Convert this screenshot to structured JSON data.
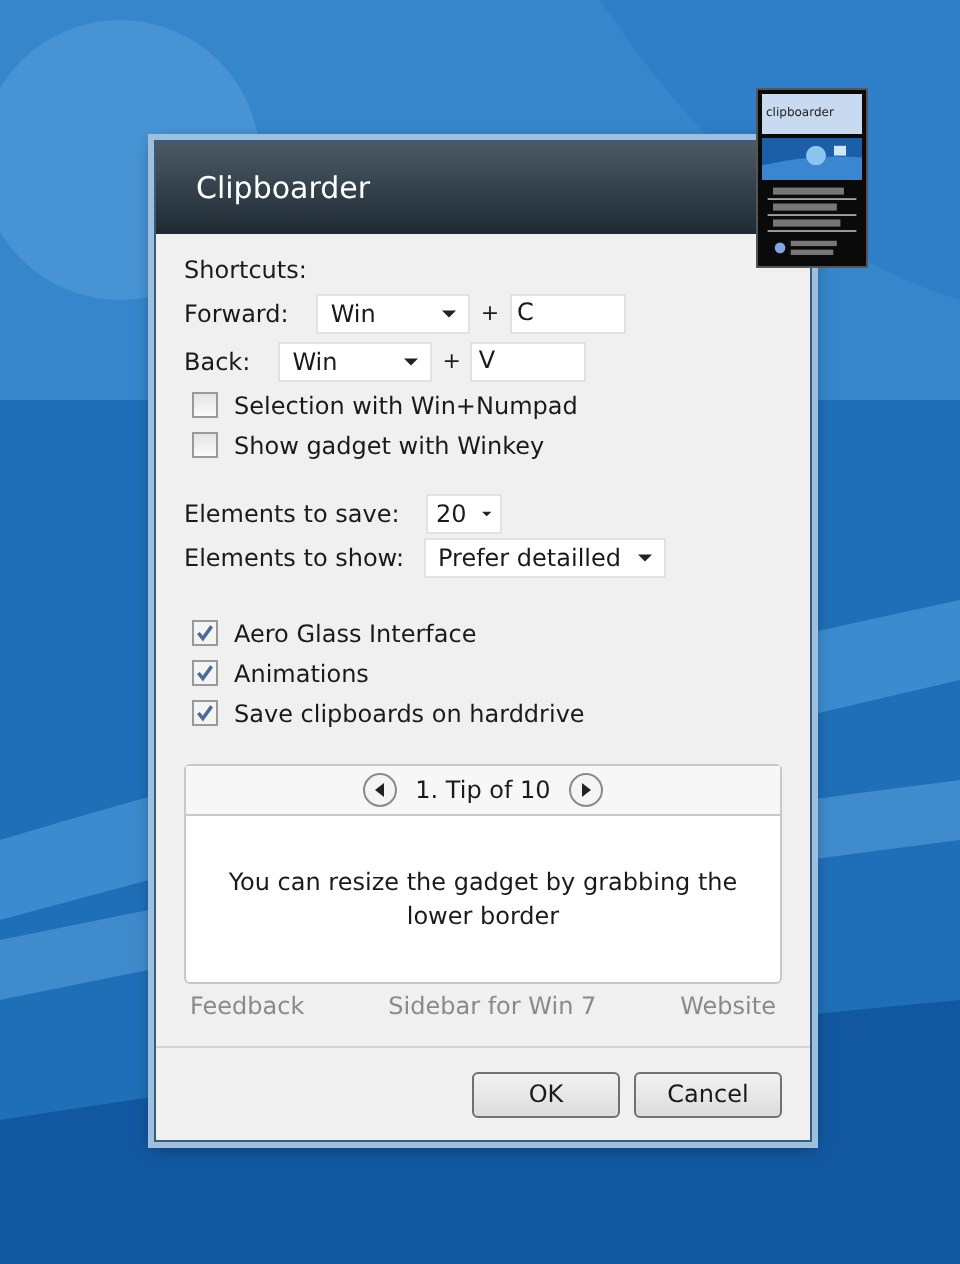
{
  "dialog": {
    "title": "Clipboarder",
    "section_label": "Shortcuts:",
    "shortcuts": [
      {
        "label": "Forward:",
        "modifier": "Win",
        "plus": "+",
        "key": "C"
      },
      {
        "label": "Back:",
        "modifier": "Win",
        "plus": "+",
        "key": "V"
      }
    ],
    "options_top": [
      {
        "label": "Selection with Win+Numpad",
        "checked": false
      },
      {
        "label": "Show gadget with Winkey",
        "checked": false
      }
    ],
    "selects": [
      {
        "label": "Elements to save:",
        "value": "20"
      },
      {
        "label": "Elements to show:",
        "value": "Prefer detailled"
      }
    ],
    "options_bottom": [
      {
        "label": "Aero Glass Interface",
        "checked": true
      },
      {
        "label": "Animations",
        "checked": true
      },
      {
        "label": "Save clipboards on harddrive",
        "checked": true
      }
    ],
    "tip": {
      "counter": "1. Tip of 10",
      "text": "You can resize the gadget by grabbing the lower border"
    },
    "links": [
      "Feedback",
      "Sidebar for Win 7",
      "Website"
    ],
    "buttons": [
      "OK",
      "Cancel"
    ]
  },
  "gadget": {
    "title": "clipboarder"
  }
}
